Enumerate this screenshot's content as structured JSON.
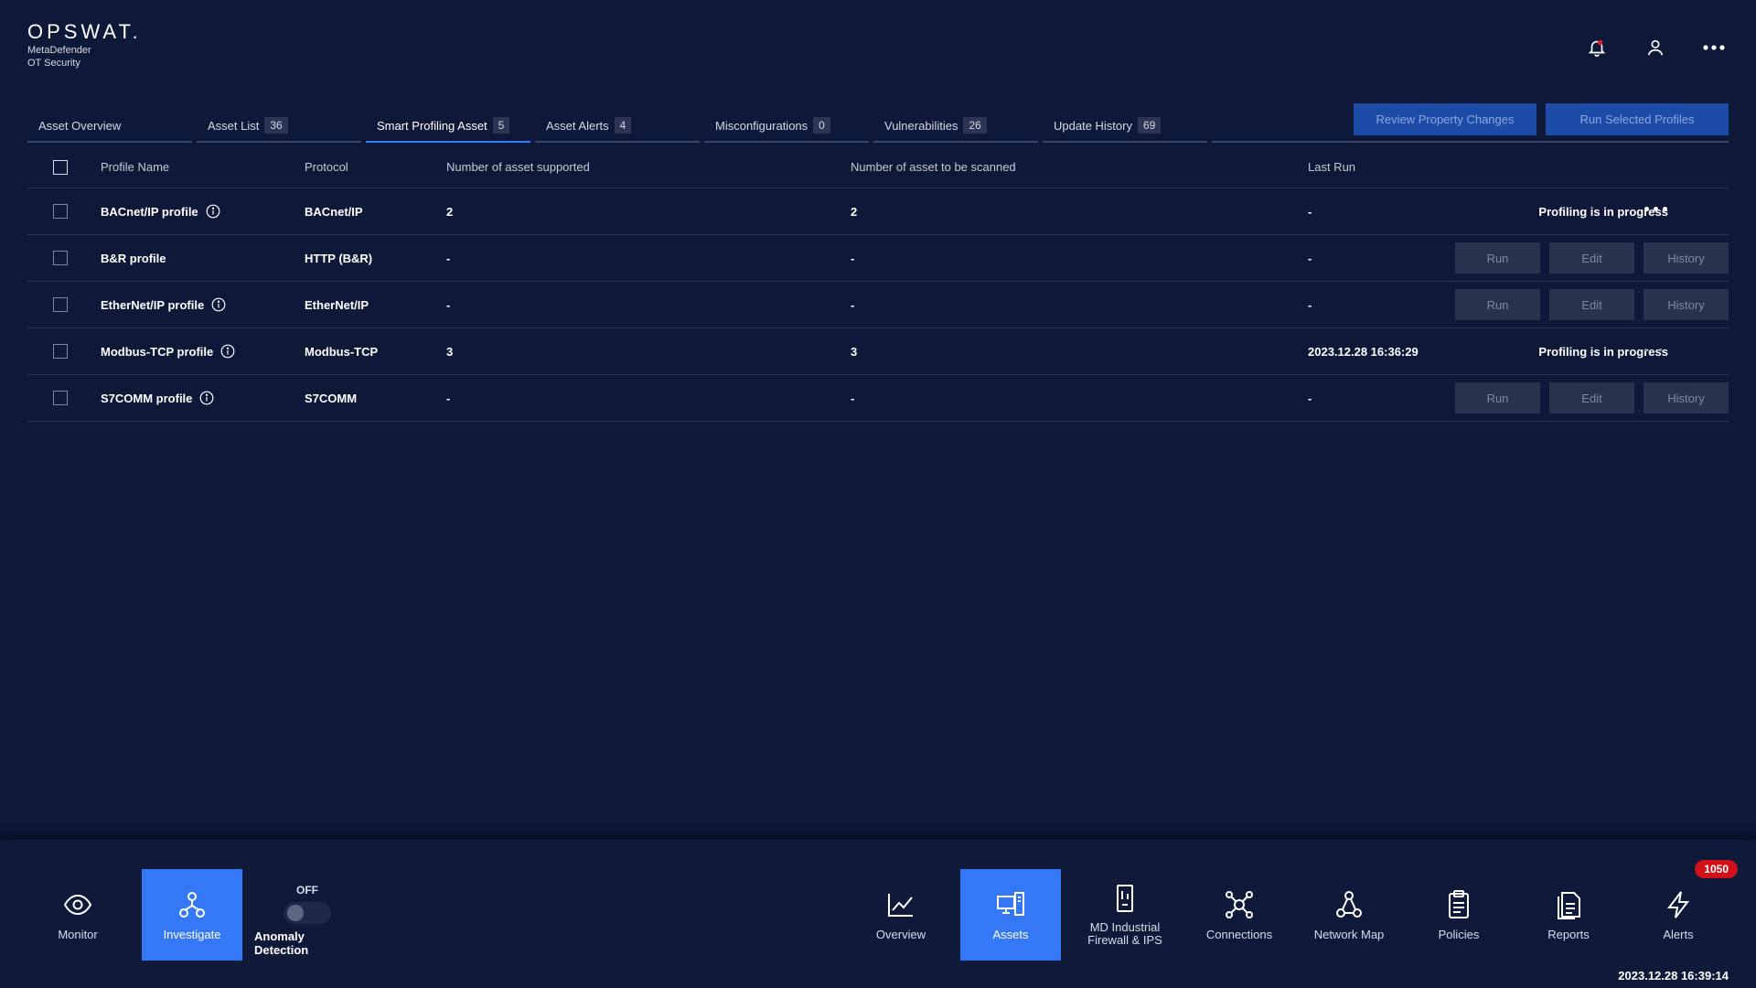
{
  "brand": {
    "logo": "OPSWAT.",
    "line1": "MetaDefender",
    "line2": "OT Security"
  },
  "tabs": [
    {
      "label": "Asset Overview",
      "count": ""
    },
    {
      "label": "Asset List",
      "count": "36"
    },
    {
      "label": "Smart Profiling Asset",
      "count": "5",
      "active": true
    },
    {
      "label": "Asset Alerts",
      "count": "4"
    },
    {
      "label": "Misconfigurations",
      "count": "0"
    },
    {
      "label": "Vulnerabilities",
      "count": "26"
    },
    {
      "label": "Update History",
      "count": "69"
    }
  ],
  "actions": {
    "review": "Review Property Changes",
    "run_selected": "Run Selected Profiles"
  },
  "table": {
    "headers": {
      "name": "Profile Name",
      "protocol": "Protocol",
      "supported": "Number of asset supported",
      "scanned": "Number of asset to be scanned",
      "last_run": "Last Run"
    },
    "rows": [
      {
        "name": "BACnet/IP profile",
        "protocol": "BACnet/IP",
        "supported": "2",
        "scanned": "2",
        "last_run": "-",
        "status": "Profiling is in progress"
      },
      {
        "name": "B&R profile",
        "protocol": "HTTP (B&R)",
        "supported": "-",
        "scanned": "-",
        "last_run": "-"
      },
      {
        "name": "EtherNet/IP profile",
        "protocol": "EtherNet/IP",
        "supported": "-",
        "scanned": "-",
        "last_run": "-"
      },
      {
        "name": "Modbus-TCP profile",
        "protocol": "Modbus-TCP",
        "supported": "3",
        "scanned": "3",
        "last_run": "2023.12.28 16:36:29",
        "status": "Profiling is in progress"
      },
      {
        "name": "S7COMM profile",
        "protocol": "S7COMM",
        "supported": "-",
        "scanned": "-",
        "last_run": "-"
      }
    ],
    "row_buttons": {
      "run": "Run",
      "edit": "Edit",
      "history": "History"
    }
  },
  "bottom_nav": {
    "monitor": "Monitor",
    "investigate": "Investigate",
    "anomaly_state": "OFF",
    "anomaly_label": "Anomaly Detection",
    "overview": "Overview",
    "assets": "Assets",
    "firewall_line1": "MD Industrial",
    "firewall_line2": "Firewall & IPS",
    "connections": "Connections",
    "network_map": "Network Map",
    "policies": "Policies",
    "reports": "Reports",
    "alerts": "Alerts",
    "alerts_badge": "1050"
  },
  "clock": "2023.12.28 16:39:14",
  "colors": {
    "accent": "#3478f6",
    "background": "#0e1838",
    "alert_badge": "#d0111a",
    "notification_dot": "#e11d2a"
  }
}
